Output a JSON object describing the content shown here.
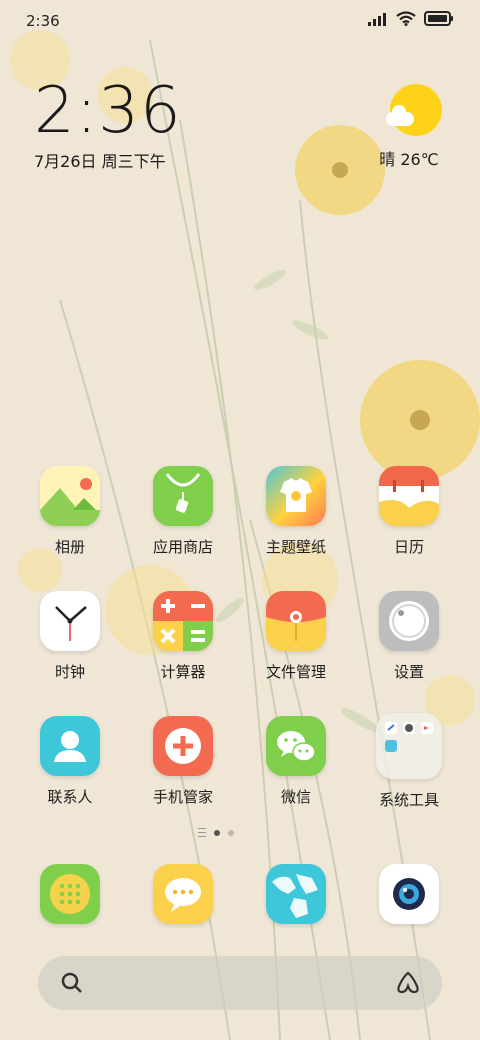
{
  "status_bar": {
    "time": "2:36",
    "signal_icon": "signal-icon",
    "wifi_icon": "wifi-icon",
    "battery_icon": "battery-icon"
  },
  "clock": {
    "time": "2:36",
    "date": "7月26日 周三下午"
  },
  "weather": {
    "text": "晴 26℃",
    "icon": "sun-cloud-icon"
  },
  "apps": [
    {
      "label": "相册"
    },
    {
      "label": "应用商店"
    },
    {
      "label": "主题壁纸"
    },
    {
      "label": "日历"
    },
    {
      "label": "时钟"
    },
    {
      "label": "计算器"
    },
    {
      "label": "文件管理"
    },
    {
      "label": "设置"
    },
    {
      "label": "联系人"
    },
    {
      "label": "手机管家"
    },
    {
      "label": "微信"
    },
    {
      "label": "系统工具"
    }
  ],
  "dock": [
    {
      "icon": "phone-dialer-icon"
    },
    {
      "icon": "messages-icon"
    },
    {
      "icon": "browser-icon"
    },
    {
      "icon": "camera-icon"
    }
  ],
  "search": {
    "search_icon": "search-icon",
    "assistant_icon": "assistant-icon"
  },
  "page_indicator": {
    "current": 1,
    "total": 2
  }
}
